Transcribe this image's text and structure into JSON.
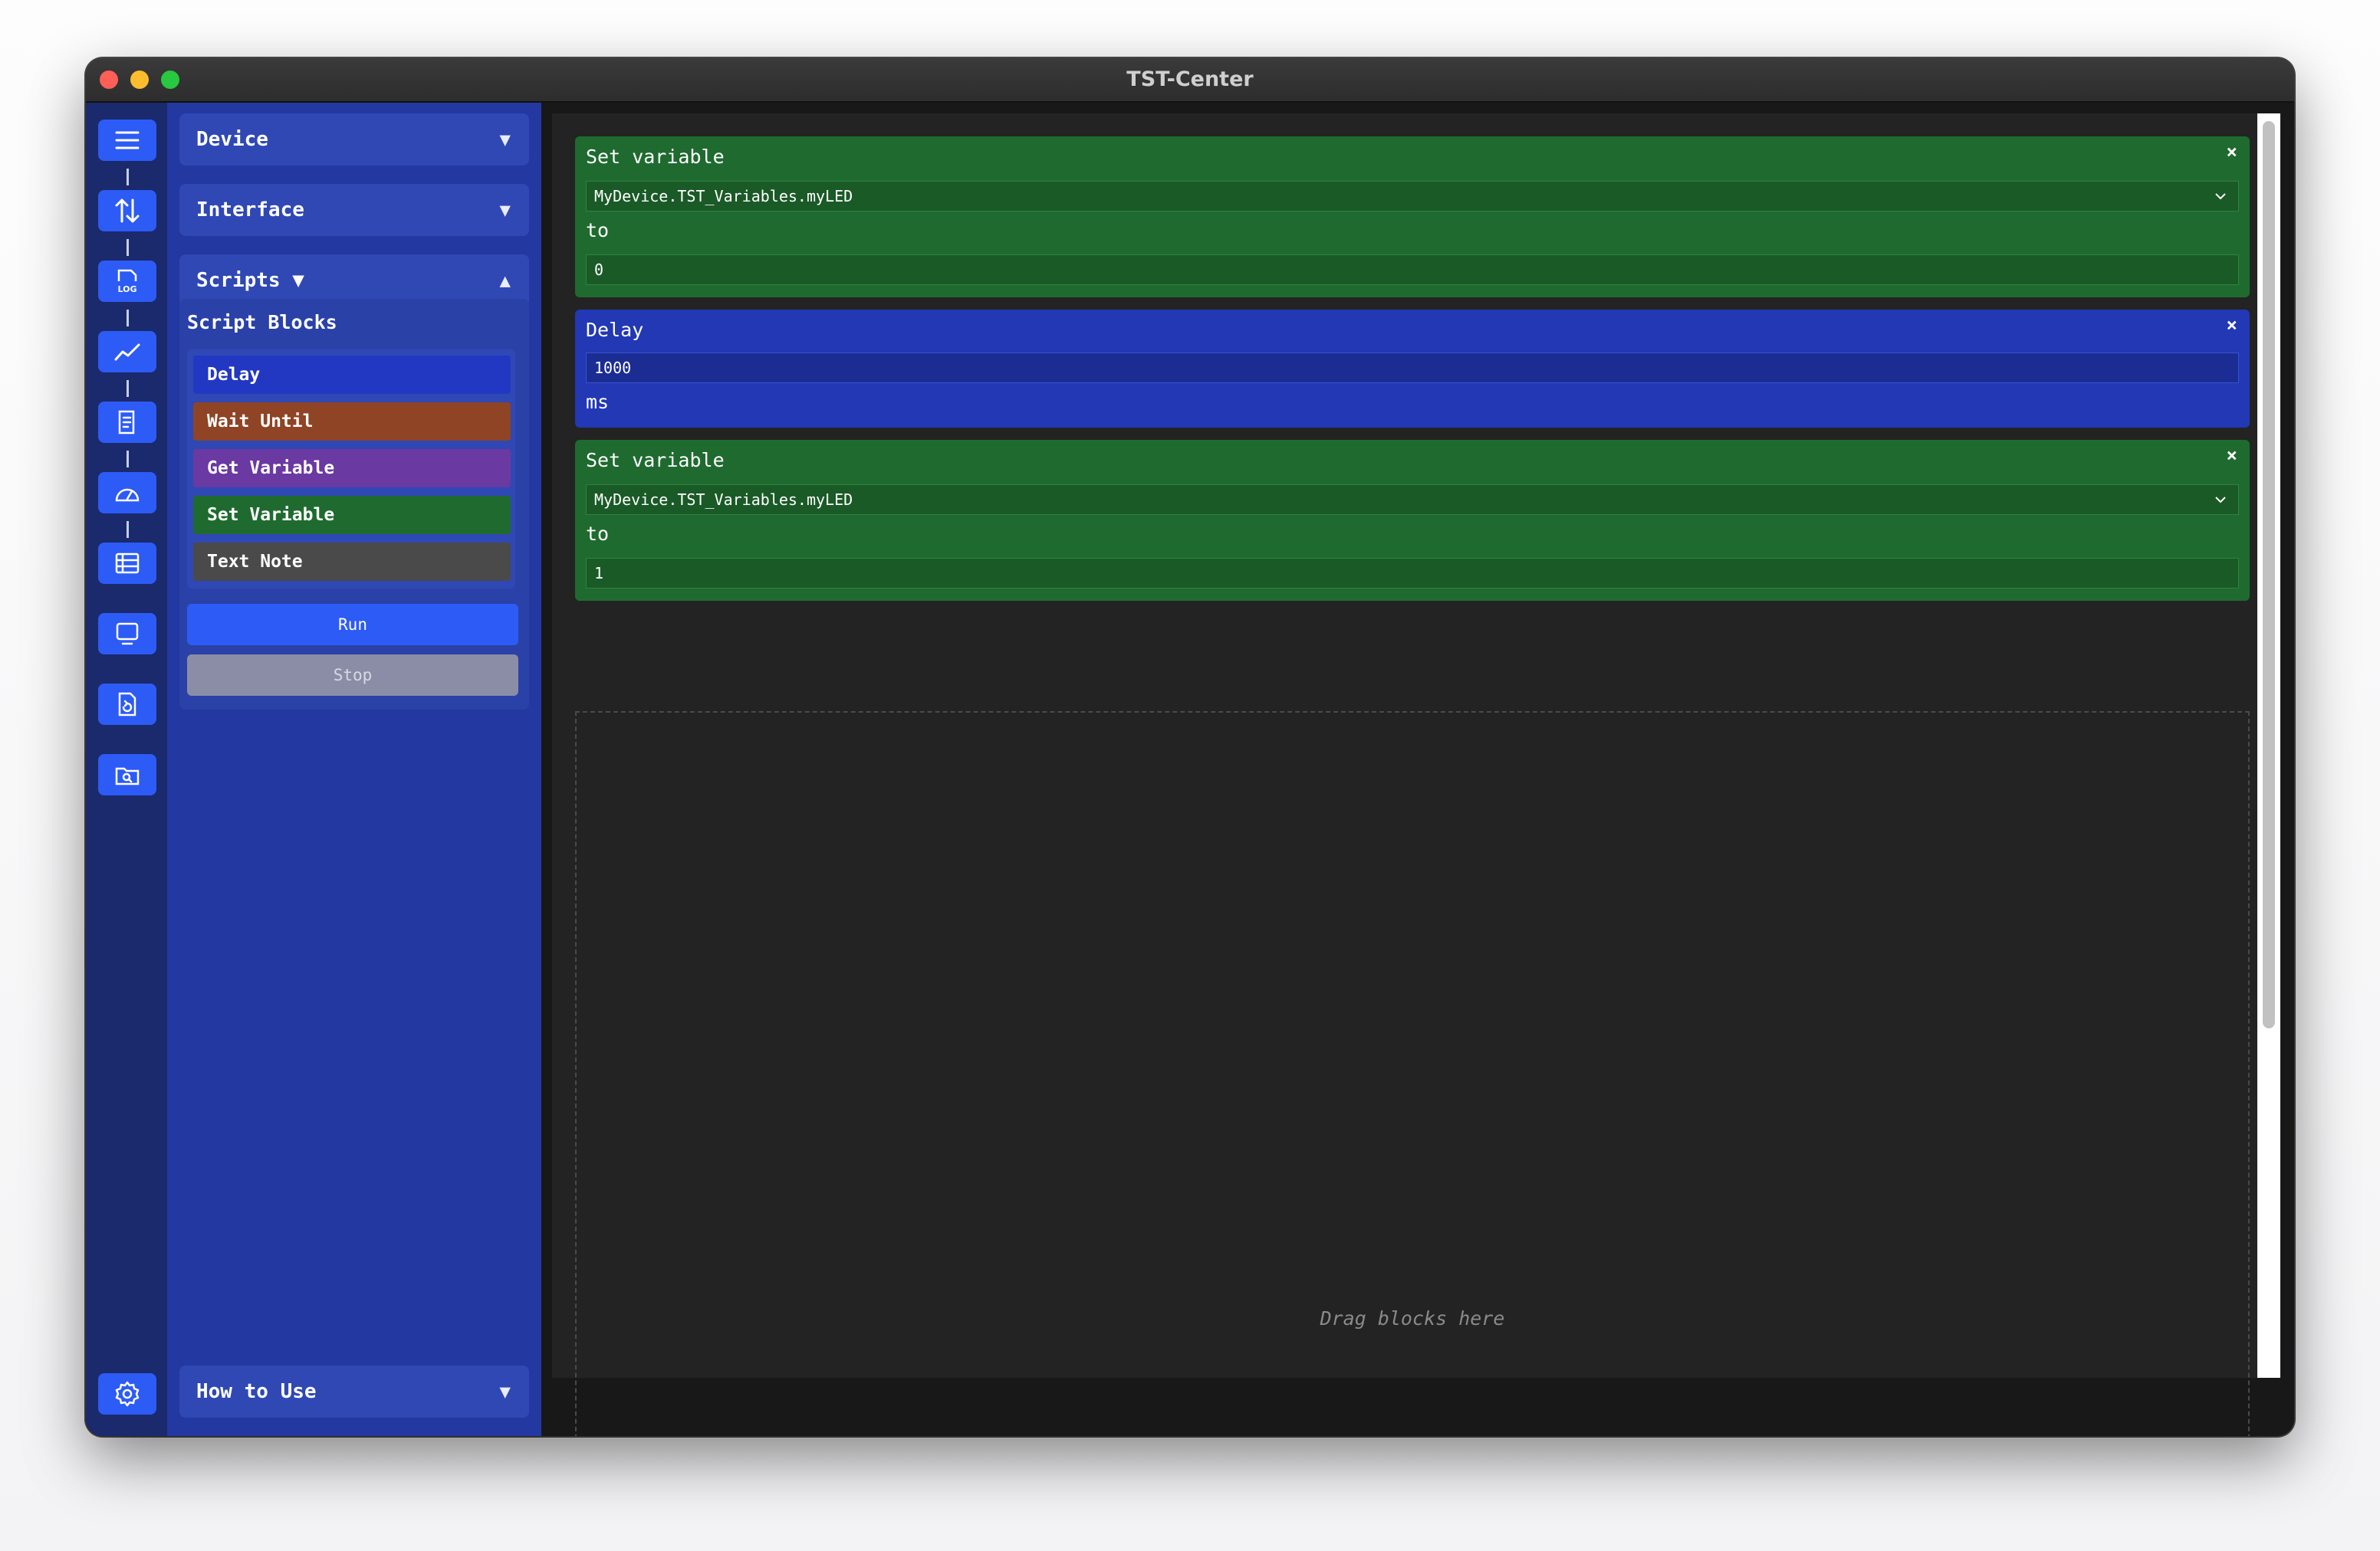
{
  "window": {
    "title": "TST-Center"
  },
  "rail": {
    "icons": [
      "menu-icon",
      "transfer-arrows-icon",
      "log-icon",
      "chart-line-icon",
      "script-document-icon",
      "gauge-icon",
      "table-icon",
      "monitor-icon",
      "file-refresh-icon",
      "folder-search-icon"
    ],
    "settings_icon": "gear-icon",
    "accent": "#2d5bf5"
  },
  "sidebar": {
    "sections": {
      "device": {
        "label": "Device",
        "caret": "▼"
      },
      "interface": {
        "label": "Interface",
        "caret": "▼"
      },
      "scripts": {
        "label": "Scripts ▼",
        "caret": "▲"
      },
      "how_to_use": {
        "label": "How to Use",
        "caret": "▼"
      }
    },
    "script_blocks_title": "Script Blocks",
    "palette": [
      {
        "label": "Delay",
        "color": "#2238c2"
      },
      {
        "label": "Wait Until",
        "color": "#8e4425"
      },
      {
        "label": "Get Variable",
        "color": "#6a39a1"
      },
      {
        "label": "Set Variable",
        "color": "#1f6b2f"
      },
      {
        "label": "Text Note",
        "color": "#4a4a4a"
      }
    ],
    "run_label": "Run",
    "stop_label": "Stop"
  },
  "workspace": {
    "blocks": [
      {
        "type": "set",
        "title": "Set variable",
        "variable": "MyDevice.TST_Variables.myLED",
        "to_label": "to",
        "value": "0",
        "close": "×"
      },
      {
        "type": "delay",
        "title": "Delay",
        "value": "1000",
        "unit": "ms",
        "close": "×"
      },
      {
        "type": "set",
        "title": "Set variable",
        "variable": "MyDevice.TST_Variables.myLED",
        "to_label": "to",
        "value": "1",
        "close": "×"
      }
    ],
    "drop_text": "Drag blocks here"
  },
  "colors": {
    "set_block": "#1f6b2f",
    "set_field": "#1a5a27",
    "delay_block": "#2238b4",
    "delay_field": "#1b2c93",
    "run_button": "#2d5bf5",
    "stop_button": "#8b8da6"
  }
}
